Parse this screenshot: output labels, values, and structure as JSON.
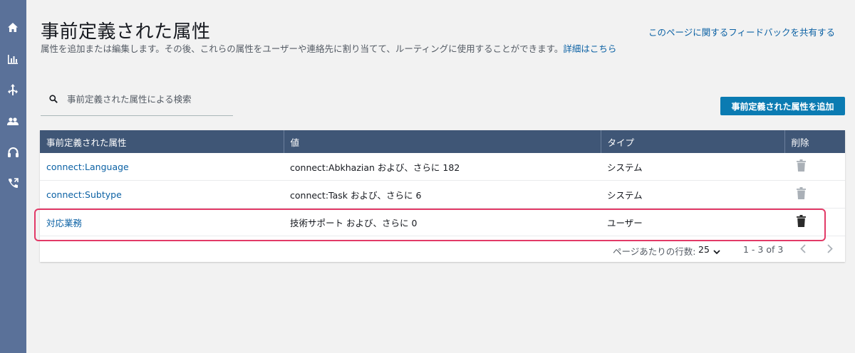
{
  "sidebar": {
    "items": [
      {
        "icon": "home-icon"
      },
      {
        "icon": "metrics-icon"
      },
      {
        "icon": "routing-icon"
      },
      {
        "icon": "users-icon"
      },
      {
        "icon": "headset-icon"
      },
      {
        "icon": "phone-icon"
      }
    ]
  },
  "page": {
    "title": "事前定義された属性",
    "description": "属性を追加または編集します。その後、これらの属性をユーザーや連絡先に割り当てて、ルーティングに使用することができます。",
    "details_link": "詳細はこちら",
    "feedback_link": "このページに関するフィードバックを共有する"
  },
  "search": {
    "placeholder": "事前定義された属性による検索",
    "value": ""
  },
  "toolbar": {
    "add_label": "事前定義された属性を追加"
  },
  "table": {
    "headers": [
      "事前定義された属性",
      "値",
      "タイプ",
      "削除"
    ],
    "rows": [
      {
        "name": "connect:Language",
        "value": "connect:Abkhazian および、さらに 182",
        "type": "システム",
        "deletable": false
      },
      {
        "name": "connect:Subtype",
        "value": "connect:Task および、さらに 6",
        "type": "システム",
        "deletable": false
      },
      {
        "name": "対応業務",
        "value": "技術サポート および、さらに 0",
        "type": "ユーザー",
        "deletable": true
      }
    ]
  },
  "pagination": {
    "rows_per_page_label": "ページあたりの行数:",
    "rows_per_page": "25",
    "range": "1 - 3 of 3"
  },
  "colors": {
    "sidebar": "#5a7199",
    "table_header": "#3f5676",
    "accent_button": "#0b7bb2",
    "link": "#0b61a4",
    "highlight": "#e23a67",
    "trash_disabled": "#aab0b7",
    "trash_enabled": "#2b2b2b"
  }
}
